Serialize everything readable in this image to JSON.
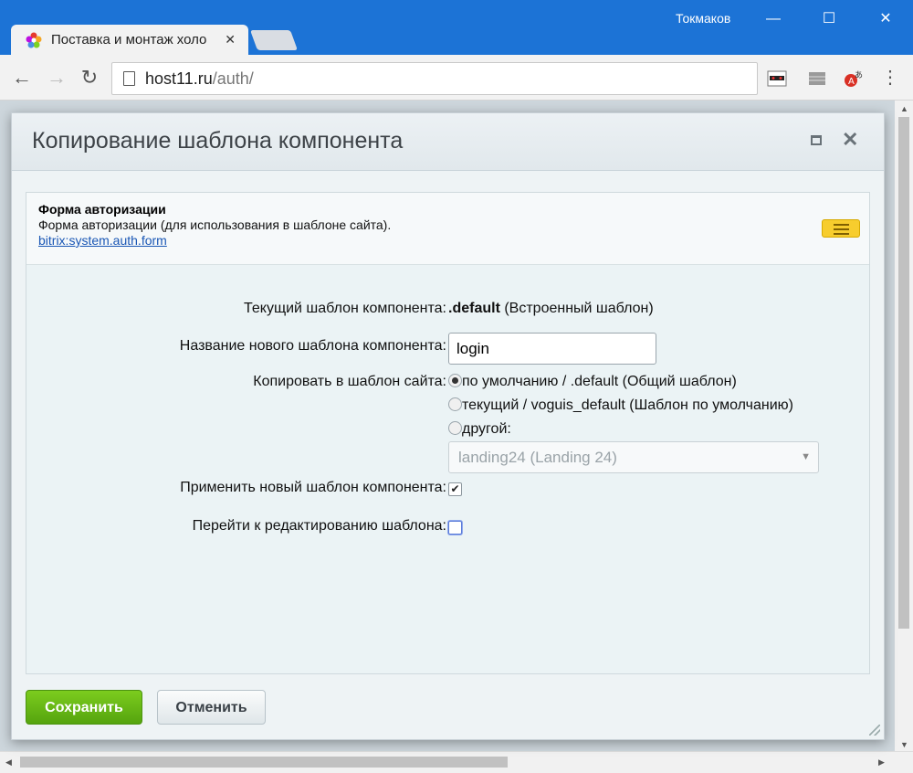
{
  "browser": {
    "user_name": "Токмаков",
    "tab_title": "Поставка и монтаж холо",
    "url_host": "host11.ru",
    "url_path": "/auth/"
  },
  "dialog": {
    "title": "Копирование шаблона компонента",
    "component": {
      "name": "Форма авторизации",
      "description": "Форма авторизации (для использования в шаблоне сайта).",
      "link": "bitrix:system.auth.form"
    },
    "fields": {
      "current_template_label": "Текущий шаблон компонента:",
      "current_template_value": ".default",
      "current_template_note": "(Встроенный шаблон)",
      "new_name_label": "Название нового шаблона компонента:",
      "new_name_value": "login",
      "copy_to_label": "Копировать в шаблон сайта:",
      "copy_options": [
        "по умолчанию / .default (Общий шаблон)",
        "текущий / voguis_default (Шаблон по умолчанию)",
        "другой:"
      ],
      "copy_selected_index": 0,
      "other_select_value": "landing24 (Landing 24)",
      "apply_label": "Применить новый шаблон компонента:",
      "apply_checked": true,
      "goto_edit_label": "Перейти к редактированию шаблона:",
      "goto_edit_checked": false
    },
    "buttons": {
      "save": "Сохранить",
      "cancel": "Отменить"
    }
  },
  "colors": {
    "chrome_blue": "#1c73d6",
    "save_green": "#6abf1a",
    "link_blue": "#1a57b5",
    "menu_yellow": "#f7cd2e"
  }
}
